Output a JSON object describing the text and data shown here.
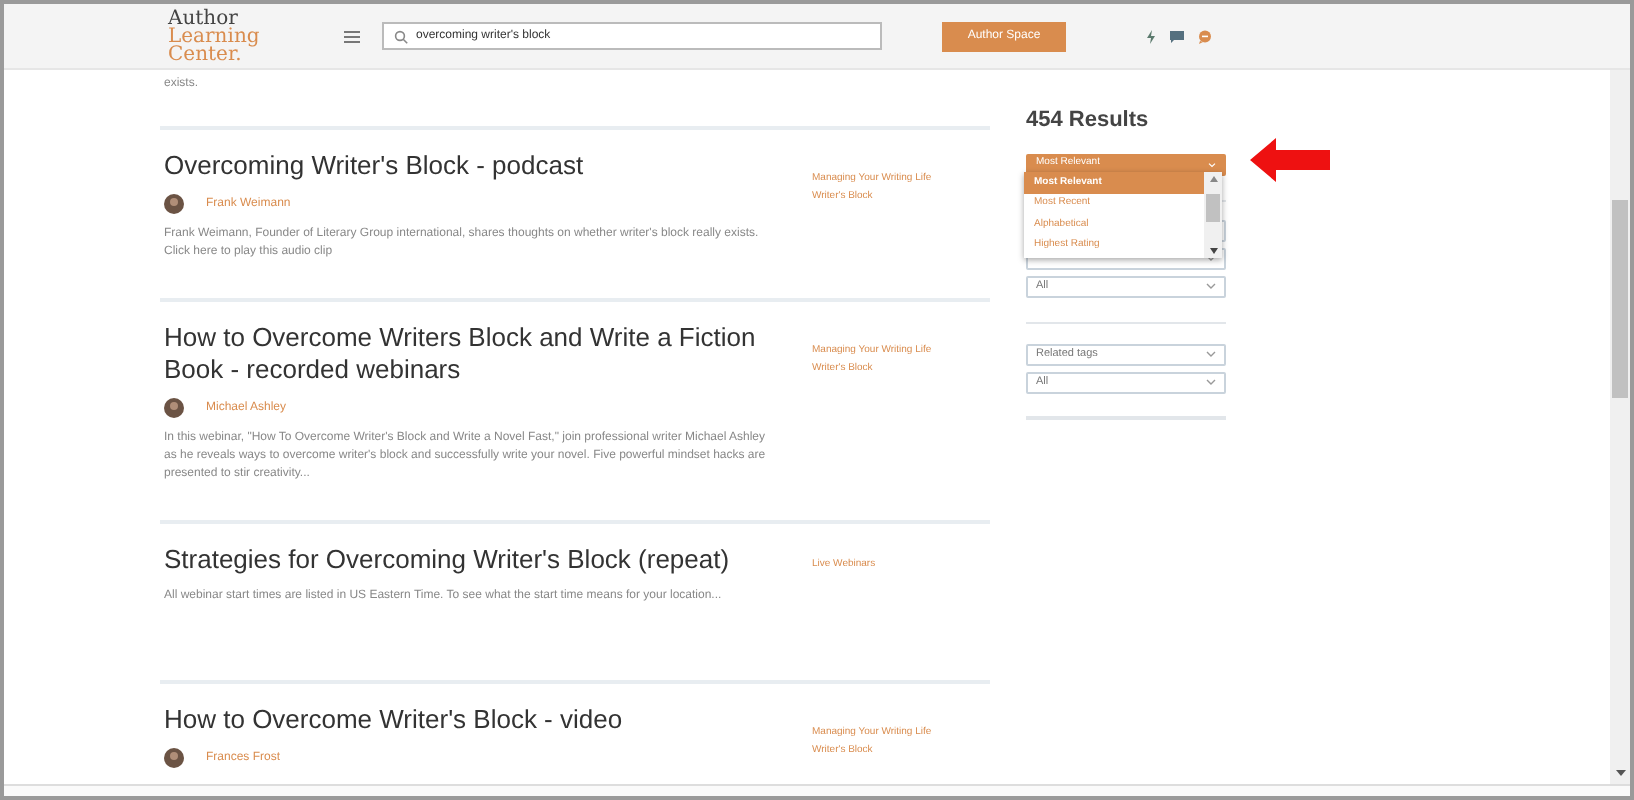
{
  "header": {
    "logo": [
      "Author",
      "Learning",
      "Center."
    ],
    "search": {
      "value": "overcoming writer's block"
    },
    "button": "Author Space"
  },
  "top_fragment": "exists.",
  "results": [
    {
      "title": "Overcoming Writer's Block - podcast",
      "author": "Frank Weimann",
      "description": "Frank Weimann, Founder of Literary Group international, shares thoughts on whether writer's block really exists. Click here to play this audio clip",
      "tags": [
        "Managing Your Writing Life",
        "Writer's Block"
      ]
    },
    {
      "title": "How to Overcome Writers Block and Write a Fiction Book - recorded webinars",
      "author": "Michael Ashley",
      "description": "In this webinar, \"How To Overcome Writer's Block and Write a Novel Fast,\" join professional writer Michael Ashley as he reveals ways to overcome writer's block and successfully write your novel. Five powerful mindset hacks are presented to stir creativity...",
      "tags": [
        "Managing Your Writing Life",
        "Writer's Block"
      ]
    },
    {
      "title": "Strategies for Overcoming Writer's Block (repeat)",
      "description": "All webinar start times are listed in US Eastern Time. To see what the start time means for your location...",
      "tags": [
        "Live Webinars"
      ]
    },
    {
      "title": "How to Overcome Writer's Block - video",
      "author": "Frances Frost",
      "tags": [
        "Managing Your Writing Life",
        "Writer's Block"
      ]
    }
  ],
  "sidebar": {
    "results_count": "454 Results",
    "sort": {
      "value": "Most Relevant",
      "options": [
        {
          "label": "Most Relevant",
          "selected": true
        },
        {
          "label": "Most Recent",
          "selected": false
        },
        {
          "label": "Alphabetical",
          "selected": false
        },
        {
          "label": "Highest Rating",
          "selected": false
        }
      ]
    },
    "filter_1": "All",
    "tags_select": "Related tags",
    "filter_2": "All"
  }
}
